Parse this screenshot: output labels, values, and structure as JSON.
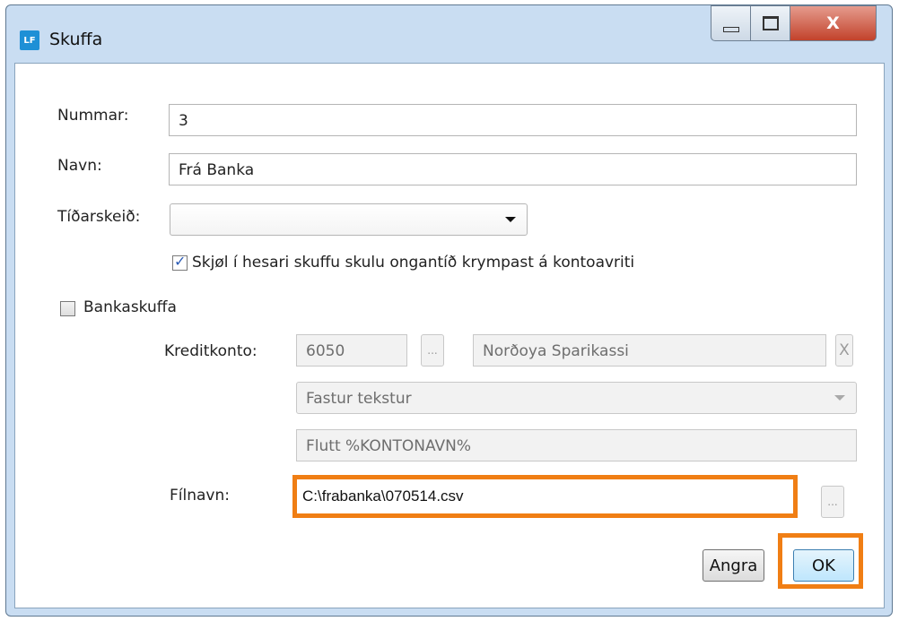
{
  "window": {
    "title": "Skuffa",
    "app_icon_text": "LF",
    "controls": {
      "minimize": "minimize",
      "maximize": "maximize",
      "close": "X"
    }
  },
  "form": {
    "nummar": {
      "label": "Nummar:",
      "value": "3"
    },
    "navn": {
      "label": "Navn:",
      "value": "Frá Banka"
    },
    "tidarskeid": {
      "label": "Tíðarskeið:",
      "value": ""
    },
    "krympast_checkbox": {
      "label": "Skjøl í hesari skuffu skulu ongantíð krympast á kontoavriti",
      "checked": true
    },
    "bankaskuffa_checkbox": {
      "label": "Bankaskuffa",
      "checked": false
    },
    "kreditkonto": {
      "label": "Kreditkonto:",
      "number": "6050",
      "browse": "...",
      "name": "Norðoya Sparikassi",
      "clear": "X"
    },
    "text_type": {
      "value": "Fastur tekstur"
    },
    "text_value": {
      "value": "Flutt %KONTONAVN%"
    },
    "filnavn": {
      "label": "Fílnavn:",
      "value": "C:\\frabanka\\070514.csv",
      "browse": "..."
    }
  },
  "buttons": {
    "cancel": "Angra",
    "ok": "OK"
  },
  "colors": {
    "highlight": "#f07e14",
    "accent": "#1e90d6"
  }
}
